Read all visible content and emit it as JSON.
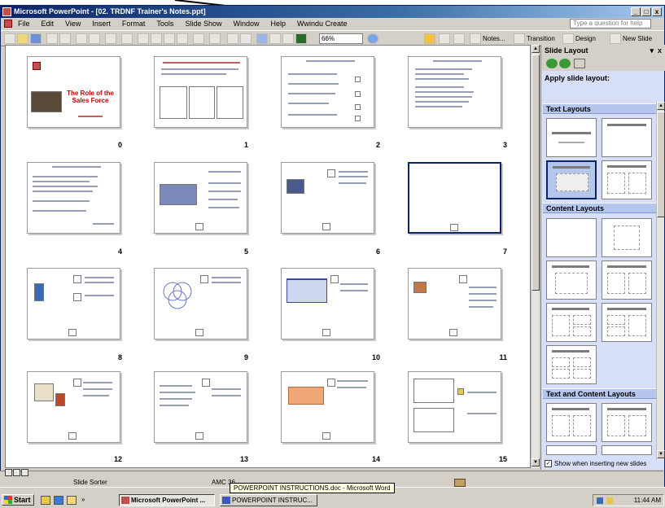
{
  "window": {
    "title": "Microsoft PowerPoint - [02. TRDNF Trainer's Notes.ppt]",
    "controls": [
      "_",
      "□",
      "x"
    ]
  },
  "menu": {
    "items": [
      "File",
      "Edit",
      "View",
      "Insert",
      "Format",
      "Tools",
      "Slide Show",
      "Window",
      "Help",
      "Wwindu Create"
    ],
    "ask_placeholder": "Type a question for help"
  },
  "toolbar": {
    "zoom": "66%",
    "notes_label": "Notes...",
    "transition_label": "Transition",
    "design_label": "Design",
    "new_slide_label": "New Slide"
  },
  "slides": [
    {
      "number": "0",
      "title": "The Role of the Sales Force"
    },
    {
      "number": "1"
    },
    {
      "number": "2"
    },
    {
      "number": "3"
    },
    {
      "number": "4"
    },
    {
      "number": "5"
    },
    {
      "number": "6"
    },
    {
      "number": "7"
    },
    {
      "number": "8"
    },
    {
      "number": "9"
    },
    {
      "number": "10"
    },
    {
      "number": "11"
    },
    {
      "number": "12"
    },
    {
      "number": "13"
    },
    {
      "number": "14"
    },
    {
      "number": "15"
    }
  ],
  "taskpane": {
    "title": "Slide Layout",
    "apply_label": "Apply slide layout:",
    "sections": [
      "Text Layouts",
      "Content Layouts",
      "Text and Content Layouts"
    ],
    "checkbox_label": "Show when inserting new slides",
    "checkbox_checked": true
  },
  "status": {
    "view": "Slide Sorter",
    "design": "AMC 36"
  },
  "tooltip": "POWERPOINT INSTRUCTIONS.doc - Microsoft Word",
  "taskbar": {
    "start": "Start",
    "tasks": [
      "Microsoft PowerPoint ...",
      "POWERPOINT INSTRUC..."
    ],
    "clock": "11:44 AM"
  },
  "colors": {
    "titlebar": "#0a246a",
    "taskpane_bg": "#d6dff7",
    "section_bg": "#b5c6ec",
    "selection": "#0a246a",
    "slide_title_red": "#c00000"
  }
}
